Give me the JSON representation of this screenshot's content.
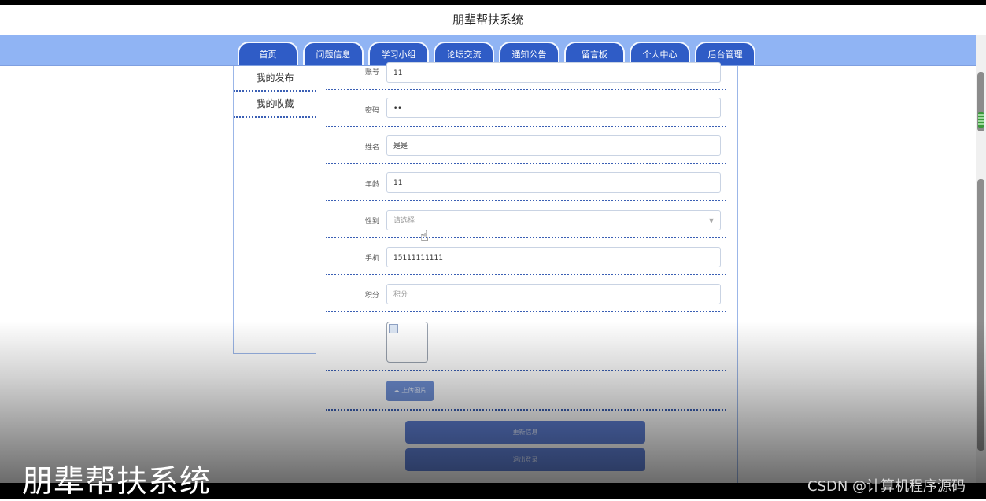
{
  "header": {
    "title": "朋辈帮扶系统"
  },
  "nav": {
    "tabs": [
      {
        "label": "首页"
      },
      {
        "label": "问题信息"
      },
      {
        "label": "学习小组"
      },
      {
        "label": "论坛交流"
      },
      {
        "label": "通知公告"
      },
      {
        "label": "留言板"
      },
      {
        "label": "个人中心"
      },
      {
        "label": "后台管理"
      }
    ]
  },
  "sidebar": {
    "items": [
      {
        "label": "我的发布"
      },
      {
        "label": "我的收藏"
      }
    ]
  },
  "form": {
    "account": {
      "label": "账号",
      "value": "11"
    },
    "password": {
      "label": "密码",
      "value": "••"
    },
    "name": {
      "label": "姓名",
      "value": "是是"
    },
    "age": {
      "label": "年龄",
      "value": "11"
    },
    "gender": {
      "label": "性别",
      "value": "请选择",
      "caret": "▼"
    },
    "phone": {
      "label": "手机",
      "value": "15111111111"
    },
    "points": {
      "label": "积分",
      "placeholder": "积分"
    },
    "upload_label": "上传图片",
    "update_button": "更新信息",
    "logout_button": "退出登录"
  },
  "overlay": {
    "big_title": "朋辈帮扶系统",
    "csdn": "CSDN @计算机程序源码"
  },
  "colors": {
    "nav_band": "#90b4f4",
    "tab": "#2f5cc6",
    "button": "#5f80d6",
    "divider": "#3a5fb4"
  }
}
